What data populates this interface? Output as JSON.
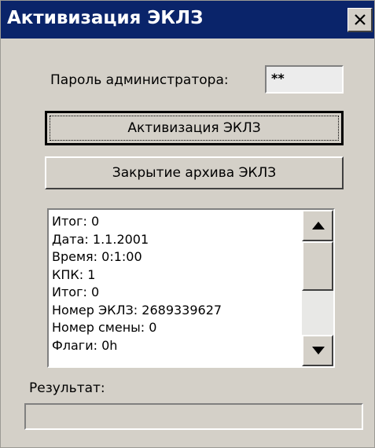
{
  "window": {
    "title": "Активизация ЭКЛЗ"
  },
  "password": {
    "label": "Пароль администратора:",
    "value": "**"
  },
  "buttons": {
    "activate_label": "Активизация ЭКЛЗ",
    "close_archive_label": "Закрытие архива ЭКЛЗ"
  },
  "log": {
    "lines": [
      "Итог: 0",
      "Дата: 1.1.2001",
      "Время: 0:1:00",
      "КПК: 1",
      "Итог: 0",
      "Номер ЭКЛЗ: 2689339627",
      "Номер смены: 0",
      "Флаги: 0h"
    ]
  },
  "result": {
    "label": "Результат:",
    "value": ""
  },
  "icons": {
    "close": "close-icon",
    "scroll_up": "arrow-up-icon",
    "scroll_down": "arrow-down-icon"
  },
  "colors": {
    "titlebar": "#0a246a",
    "window_bg": "#d4d0c8"
  }
}
